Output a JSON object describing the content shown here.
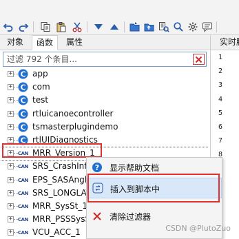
{
  "toolbar": {
    "icons": [
      "undo-icon",
      "redo-icon",
      "copy-icon",
      "paste-icon",
      "cut-icon",
      "move-down-icon",
      "move-up-icon",
      "open-folder-icon",
      "save-icon",
      "replace-icon",
      "find-icon",
      "settings-icon",
      "comment-icon"
    ]
  },
  "tabs": {
    "objects": "对象",
    "functions": "函数",
    "properties": "属性",
    "active": "functions"
  },
  "filter": {
    "placeholder": "过滤 792 个条目..."
  },
  "tree": {
    "items": [
      {
        "label": "app",
        "type": "namespace"
      },
      {
        "label": "com",
        "type": "namespace"
      },
      {
        "label": "test",
        "type": "namespace"
      },
      {
        "label": "rtluicanoecontroller",
        "type": "namespace"
      },
      {
        "label": "tsmasterplugindemo",
        "type": "namespace"
      },
      {
        "label": "rtlUIDiagnostics",
        "type": "namespace"
      },
      {
        "label": "MRR_Version_1",
        "type": "can"
      },
      {
        "label": "SRS_CrashInfo",
        "type": "can"
      },
      {
        "label": "EPS_SASAngle",
        "type": "can"
      },
      {
        "label": "SRS_LONGLAT",
        "type": "can"
      },
      {
        "label": "MRR_SysSt_1",
        "type": "can"
      },
      {
        "label": "MRR_PSSSysSt",
        "type": "can"
      },
      {
        "label": "VCU_ACC_1",
        "type": "can"
      }
    ],
    "can_badge": "CAN"
  },
  "right_panel": {
    "tab_label": "实时脚",
    "line_numbers": [
      "1",
      "2",
      "3",
      "4",
      "5",
      "6",
      "7",
      "8"
    ]
  },
  "context_menu": {
    "items": [
      {
        "label": "显示帮助文档",
        "icon": "help-icon"
      },
      {
        "label": "插入到脚本中",
        "icon": "insert-icon"
      },
      {
        "label": "清除过滤器",
        "icon": "clear-icon"
      }
    ]
  },
  "watermark": "CSDN @PlutoZuo",
  "colors": {
    "accent_red": "#e03030",
    "icon_blue": "#1e6fd0",
    "hover_blue": "#d9e8f8"
  }
}
